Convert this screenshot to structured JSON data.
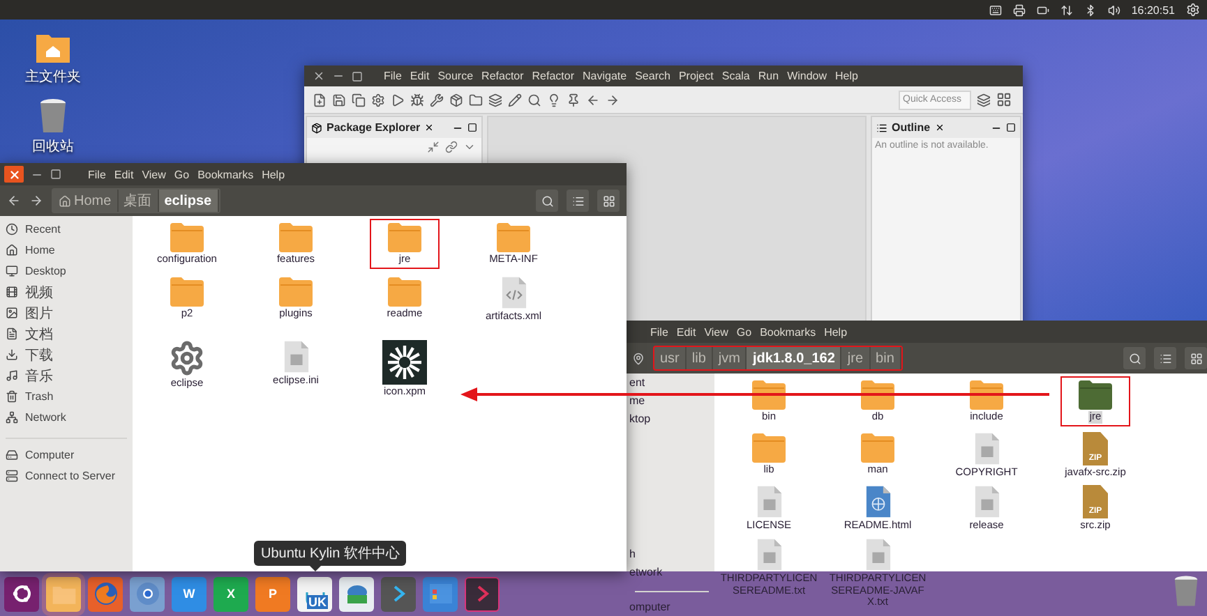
{
  "top_panel": {
    "clock": "16:20:51"
  },
  "desktop_icons": [
    {
      "label": "主文件夹",
      "kind": "home-folder"
    },
    {
      "label": "回收站",
      "kind": "trash"
    }
  ],
  "eclipse": {
    "menu": [
      "File",
      "Edit",
      "Source",
      "Refactor",
      "Refactor",
      "Navigate",
      "Search",
      "Project",
      "Scala",
      "Run",
      "Window",
      "Help"
    ],
    "quick_access": {
      "placeholder": "Quick Access"
    },
    "package_explorer": {
      "title": "Package Explorer"
    },
    "outline": {
      "title": "Outline",
      "message": "An outline is not available."
    }
  },
  "file_manager_left": {
    "menu": [
      "File",
      "Edit",
      "View",
      "Go",
      "Bookmarks",
      "Help"
    ],
    "path": [
      {
        "label": "Home",
        "selected": false
      },
      {
        "label": "桌面",
        "selected": false
      },
      {
        "label": "eclipse",
        "selected": true
      }
    ],
    "sidebar": [
      {
        "label": "Recent",
        "kind": "recent"
      },
      {
        "label": "Home",
        "kind": "home"
      },
      {
        "label": "Desktop",
        "kind": "desktop"
      },
      {
        "label": "视频",
        "kind": "videos"
      },
      {
        "label": "图片",
        "kind": "pictures"
      },
      {
        "label": "文档",
        "kind": "documents"
      },
      {
        "label": "下载",
        "kind": "downloads"
      },
      {
        "label": "音乐",
        "kind": "music"
      },
      {
        "label": "Trash",
        "kind": "trash"
      },
      {
        "label": "Network",
        "kind": "network"
      },
      {
        "label": "Computer",
        "kind": "computer"
      },
      {
        "label": "Connect to Server",
        "kind": "server"
      }
    ],
    "items": [
      {
        "label": "configuration",
        "kind": "folder",
        "selected": false,
        "marked": false
      },
      {
        "label": "features",
        "kind": "folder",
        "selected": false,
        "marked": false
      },
      {
        "label": "jre",
        "kind": "folder",
        "selected": false,
        "marked": true
      },
      {
        "label": "META-INF",
        "kind": "folder",
        "selected": false,
        "marked": false
      },
      {
        "label": "p2",
        "kind": "folder",
        "selected": false,
        "marked": false
      },
      {
        "label": "plugins",
        "kind": "folder",
        "selected": false,
        "marked": false
      },
      {
        "label": "readme",
        "kind": "folder",
        "selected": false,
        "marked": false
      },
      {
        "label": "artifacts.xml",
        "kind": "xml",
        "selected": false,
        "marked": false
      },
      {
        "label": "eclipse",
        "kind": "executable",
        "selected": false,
        "marked": false
      },
      {
        "label": "eclipse.ini",
        "kind": "text",
        "selected": false,
        "marked": false
      },
      {
        "label": "icon.xpm",
        "kind": "image",
        "selected": false,
        "marked": false
      }
    ]
  },
  "file_manager_right": {
    "menu": [
      "File",
      "Edit",
      "View",
      "Go",
      "Bookmarks",
      "Help"
    ],
    "path_marked": true,
    "path": [
      {
        "label": "usr",
        "selected": false
      },
      {
        "label": "lib",
        "selected": false
      },
      {
        "label": "jvm",
        "selected": false
      },
      {
        "label": "jdk1.8.0_162",
        "selected": true
      },
      {
        "label": "jre",
        "selected": false
      },
      {
        "label": "bin",
        "selected": false
      }
    ],
    "sidebar_top": [
      {
        "label": "ent"
      },
      {
        "label": "me"
      },
      {
        "label": "ktop"
      }
    ],
    "sidebar_bottom": [
      {
        "label": "h"
      },
      {
        "label": "etwork"
      },
      {
        "label": "omputer"
      }
    ],
    "items": [
      {
        "label": "bin",
        "kind": "folder",
        "selected": false,
        "marked": false
      },
      {
        "label": "db",
        "kind": "folder",
        "selected": false,
        "marked": false
      },
      {
        "label": "include",
        "kind": "folder",
        "selected": false,
        "marked": false
      },
      {
        "label": "jre",
        "kind": "folder",
        "selected": true,
        "marked": true
      },
      {
        "label": "lib",
        "kind": "folder",
        "selected": false,
        "marked": false
      },
      {
        "label": "man",
        "kind": "folder",
        "selected": false,
        "marked": false
      },
      {
        "label": "COPYRIGHT",
        "kind": "text",
        "selected": false,
        "marked": false
      },
      {
        "label": "javafx-src.zip",
        "kind": "zip",
        "badge": "ZIP",
        "selected": false,
        "marked": false
      },
      {
        "label": "LICENSE",
        "kind": "text",
        "selected": false,
        "marked": false
      },
      {
        "label": "README.html",
        "kind": "html",
        "selected": false,
        "marked": false
      },
      {
        "label": "release",
        "kind": "text",
        "selected": false,
        "marked": false
      },
      {
        "label": "src.zip",
        "kind": "zip",
        "badge": "ZIP",
        "selected": false,
        "marked": false
      },
      {
        "label": "THIRDPARTYLICENSEREADME.txt",
        "kind": "text",
        "selected": false,
        "marked": false
      },
      {
        "label": "THIRDPARTYLICENSEREADME-JAVAFX.txt",
        "kind": "text",
        "selected": false,
        "marked": false
      }
    ]
  },
  "dock": {
    "tooltip": "Ubuntu Kylin 软件中心",
    "apps": [
      {
        "kind": "ubuntu",
        "selected": false,
        "focused": false
      },
      {
        "kind": "files",
        "selected": true,
        "focused": false
      },
      {
        "kind": "firefox",
        "selected": false,
        "focused": false
      },
      {
        "kind": "chromium",
        "selected": false,
        "focused": false
      },
      {
        "kind": "word",
        "label": "W",
        "selected": false,
        "focused": false
      },
      {
        "kind": "excel",
        "label": "X",
        "selected": false,
        "focused": false
      },
      {
        "kind": "slides",
        "label": "P",
        "selected": false,
        "focused": false
      },
      {
        "kind": "store",
        "label": "UK",
        "selected": false,
        "focused": false
      },
      {
        "kind": "mail",
        "selected": false,
        "focused": false
      },
      {
        "kind": "chevron",
        "selected": false,
        "focused": false
      },
      {
        "kind": "windows",
        "selected": false,
        "focused": false
      },
      {
        "kind": "terminal",
        "selected": false,
        "focused": true
      }
    ]
  }
}
